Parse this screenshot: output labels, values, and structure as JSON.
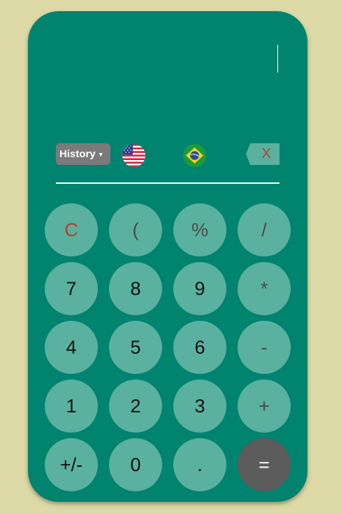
{
  "display": {
    "value": ""
  },
  "toolbar": {
    "history_label": "History",
    "history_chevron_icon": "chevron-down-icon",
    "flags": [
      "us-flag-icon",
      "brazil-flag-icon"
    ],
    "backspace_label": "X"
  },
  "keys": [
    {
      "label": "C",
      "kind": "clear"
    },
    {
      "label": "(",
      "kind": "op"
    },
    {
      "label": "%",
      "kind": "op"
    },
    {
      "label": "/",
      "kind": "op"
    },
    {
      "label": "7",
      "kind": "digit"
    },
    {
      "label": "8",
      "kind": "digit"
    },
    {
      "label": "9",
      "kind": "digit"
    },
    {
      "label": "*",
      "kind": "op"
    },
    {
      "label": "4",
      "kind": "digit"
    },
    {
      "label": "5",
      "kind": "digit"
    },
    {
      "label": "6",
      "kind": "digit"
    },
    {
      "label": "-",
      "kind": "op"
    },
    {
      "label": "1",
      "kind": "digit"
    },
    {
      "label": "2",
      "kind": "digit"
    },
    {
      "label": "3",
      "kind": "digit"
    },
    {
      "label": "+",
      "kind": "op"
    },
    {
      "label": "+/-",
      "kind": "digit"
    },
    {
      "label": "0",
      "kind": "digit"
    },
    {
      "label": ".",
      "kind": "digit"
    },
    {
      "label": "=",
      "kind": "equals"
    }
  ],
  "colors": {
    "page_background": "#dcd9a6",
    "calculator_body": "#00836f",
    "key_background": "#5ab19f",
    "equals_background": "#5c5c5c",
    "clear_text": "#c0392b"
  }
}
